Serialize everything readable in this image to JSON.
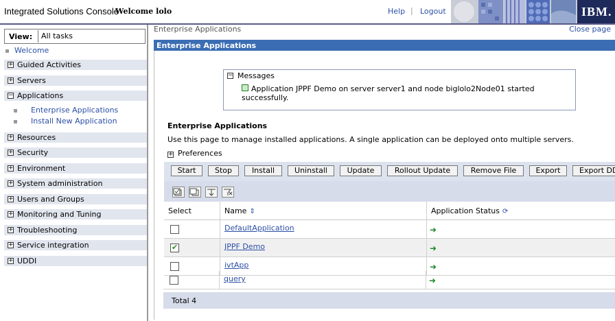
{
  "header": {
    "app_title": "Integrated Solutions Console",
    "welcome": "Welcome lolo",
    "help": "Help",
    "separator": "|",
    "logout": "Logout",
    "brand": "IBM."
  },
  "nav": {
    "view_label": "View:",
    "view_value": "All tasks",
    "welcome": "Welcome",
    "groups": [
      {
        "label": "Guided Activities",
        "state": "+"
      },
      {
        "label": "Servers",
        "state": "+"
      },
      {
        "label": "Applications",
        "state": "-"
      },
      {
        "label": "Resources",
        "state": "+"
      },
      {
        "label": "Security",
        "state": "+"
      },
      {
        "label": "Environment",
        "state": "+"
      },
      {
        "label": "System administration",
        "state": "+"
      },
      {
        "label": "Users and Groups",
        "state": "+"
      },
      {
        "label": "Monitoring and Tuning",
        "state": "+"
      },
      {
        "label": "Troubleshooting",
        "state": "+"
      },
      {
        "label": "Service integration",
        "state": "+"
      },
      {
        "label": "UDDI",
        "state": "+"
      }
    ],
    "app_subitems": [
      "Enterprise Applications",
      "Install New Application"
    ]
  },
  "main": {
    "breadcrumb": "Enterprise Applications",
    "close_page": "Close page",
    "panel_title": "Enterprise Applications",
    "messages_title": "Messages",
    "message_text": "Application JPPF Demo on server server1 and node biglolo2Node01 started successfully.",
    "heading": "Enterprise Applications",
    "description": "Use this page to manage installed applications. A single application can be deployed onto multiple servers.",
    "preferences": "Preferences",
    "buttons": [
      "Start",
      "Stop",
      "Install",
      "Uninstall",
      "Update",
      "Rollout Update",
      "Remove File",
      "Export",
      "Export DDL"
    ],
    "table": {
      "col_select": "Select",
      "col_name": "Name",
      "col_status": "Application Status",
      "rows": [
        {
          "name": "DefaultApplication",
          "checked": false
        },
        {
          "name": "JPPF Demo",
          "checked": true
        },
        {
          "name": "ivtApp",
          "checked": false
        },
        {
          "name": "query",
          "checked": false
        }
      ],
      "total": "Total 4"
    }
  },
  "colors": {
    "accent": "#3b6db3",
    "link": "#2b4fa6",
    "nav_bg": "#e1e5ee",
    "status_ok": "#1a8a2a"
  }
}
